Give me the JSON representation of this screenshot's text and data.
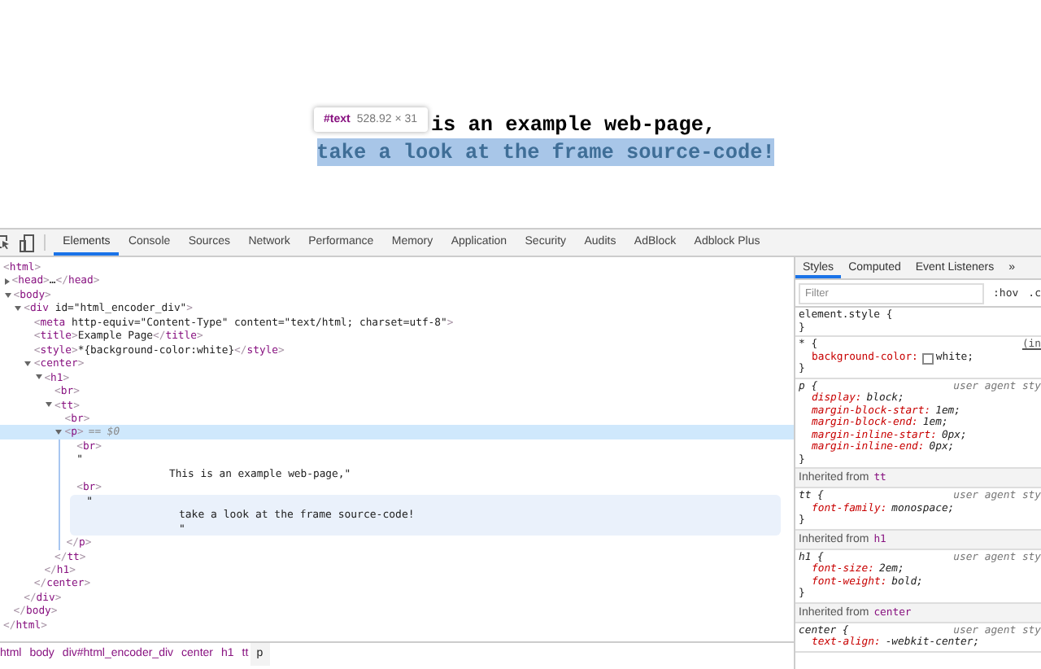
{
  "page": {
    "lines": [
      {
        "text": "is an example web-page,",
        "highlighted": false,
        "covered_prefix": true
      },
      {
        "text": "take a look at the frame source-code!",
        "highlighted": true,
        "covered_prefix": false
      }
    ],
    "tooltip": {
      "node": "#text",
      "size": "528.92 × 31"
    }
  },
  "devtools": {
    "tabs": [
      {
        "label": "Elements",
        "selected": true
      },
      {
        "label": "Console",
        "selected": false
      },
      {
        "label": "Sources",
        "selected": false
      },
      {
        "label": "Network",
        "selected": false
      },
      {
        "label": "Performance",
        "selected": false
      },
      {
        "label": "Memory",
        "selected": false
      },
      {
        "label": "Application",
        "selected": false
      },
      {
        "label": "Security",
        "selected": false
      },
      {
        "label": "Audits",
        "selected": false
      },
      {
        "label": "AdBlock",
        "selected": false
      },
      {
        "label": "Adblock Plus",
        "selected": false
      }
    ],
    "dom": [
      {
        "kind": "element",
        "markup": "<html>",
        "close": "</html>",
        "selected": false,
        "children": [
          {
            "kind": "element",
            "markup": "<head>…</head>",
            "expanded": false,
            "selected": false
          },
          {
            "kind": "element",
            "markup": "<body>",
            "close": "</body>",
            "expanded": true,
            "selected": false,
            "children": [
              {
                "kind": "element",
                "markup": "<div id=\"html_encoder_div\">",
                "close": "</div>",
                "expanded": true,
                "selected": false,
                "children": [
                  {
                    "kind": "element",
                    "markup": "<meta http-equiv=\"Content-Type\" content=\"text/html; charset=utf-8\">",
                    "selected": false
                  },
                  {
                    "kind": "element",
                    "markup": "<title>Example Page</title>",
                    "selected": false
                  },
                  {
                    "kind": "element",
                    "markup": "<style>*{background-color:white}</style>",
                    "selected": false
                  },
                  {
                    "kind": "element",
                    "markup": "<center>",
                    "close": "</center>",
                    "expanded": true,
                    "selected": false,
                    "children": [
                      {
                        "kind": "element",
                        "markup": "<h1>",
                        "close": "</h1>",
                        "expanded": true,
                        "selected": false,
                        "children": [
                          {
                            "kind": "element",
                            "markup": "<br>",
                            "selected": false
                          },
                          {
                            "kind": "element",
                            "markup": "<tt>",
                            "close": "</tt>",
                            "expanded": true,
                            "selected": false,
                            "children": [
                              {
                                "kind": "element",
                                "markup": "<br>",
                                "selected": false
                              },
                              {
                                "kind": "element",
                                "markup": "<p>",
                                "marker": "== $0",
                                "close": "</p>",
                                "expanded": true,
                                "selected": true,
                                "children": [
                                  {
                                    "kind": "element",
                                    "markup": "<br>",
                                    "selected": false
                                  },
                                  {
                                    "kind": "text",
                                    "lines": [
                                      "\"",
                                      "This is an example web-page,\""
                                    ],
                                    "selected": false,
                                    "hovered": false
                                  },
                                  {
                                    "kind": "element",
                                    "markup": "<br>",
                                    "selected": false
                                  },
                                  {
                                    "kind": "text",
                                    "lines": [
                                      "\"",
                                      "take a look at the frame source-code!",
                                      "\""
                                    ],
                                    "selected": false,
                                    "hovered": true
                                  }
                                ]
                              }
                            ]
                          }
                        ]
                      }
                    ]
                  }
                ]
              }
            ]
          }
        ]
      }
    ],
    "breadcrumbs": [
      {
        "label": "html",
        "selected": false
      },
      {
        "label": "body",
        "selected": false
      },
      {
        "label": "div#html_encoder_div",
        "selected": false
      },
      {
        "label": "center",
        "selected": false
      },
      {
        "label": "h1",
        "selected": false
      },
      {
        "label": "tt",
        "selected": false
      },
      {
        "label": "p",
        "selected": true
      }
    ],
    "styles": {
      "tabs": [
        {
          "label": "Styles",
          "selected": true
        },
        {
          "label": "Computed",
          "selected": false
        },
        {
          "label": "Event Listeners",
          "selected": false
        }
      ],
      "more": "»",
      "filter": {
        "placeholder": "Filter"
      },
      "hov": ":hov",
      "cls": ".c",
      "sections": [
        {
          "kind": "inline-rule",
          "selector": "element.style {",
          "closing": "}"
        },
        {
          "kind": "author-rule",
          "selector": "* {",
          "source": "(in",
          "declarations": [
            {
              "property": "background-color:",
              "value": "white;",
              "color": "#ffffff"
            }
          ],
          "closing": "}"
        },
        {
          "kind": "ua-rule",
          "selector": "p {",
          "source": "user agent sty",
          "declarations": [
            {
              "property": "display:",
              "value": "block;"
            },
            {
              "property": "margin-block-start:",
              "value": "1em;"
            },
            {
              "property": "margin-block-end:",
              "value": "1em;"
            },
            {
              "property": "margin-inline-start:",
              "value": "0px;"
            },
            {
              "property": "margin-inline-end:",
              "value": "0px;"
            }
          ],
          "closing": "}"
        },
        {
          "kind": "inherited",
          "label": "Inherited from",
          "element": "tt"
        },
        {
          "kind": "ua-rule",
          "selector": "tt {",
          "source": "user agent sty",
          "declarations": [
            {
              "property": "font-family:",
              "value": "monospace;"
            }
          ],
          "closing": "}"
        },
        {
          "kind": "inherited",
          "label": "Inherited from",
          "element": "h1"
        },
        {
          "kind": "ua-rule",
          "selector": "h1 {",
          "source": "user agent sty",
          "declarations": [
            {
              "property": "font-size:",
              "value": "2em;"
            },
            {
              "property": "font-weight:",
              "value": "bold;"
            }
          ],
          "closing": "}"
        },
        {
          "kind": "inherited",
          "label": "Inherited from",
          "element": "center"
        },
        {
          "kind": "ua-rule",
          "selector": "center {",
          "source": "user agent sty",
          "declarations": [
            {
              "property": "text-align:",
              "value": "-webkit-center;"
            }
          ]
        }
      ]
    }
  }
}
